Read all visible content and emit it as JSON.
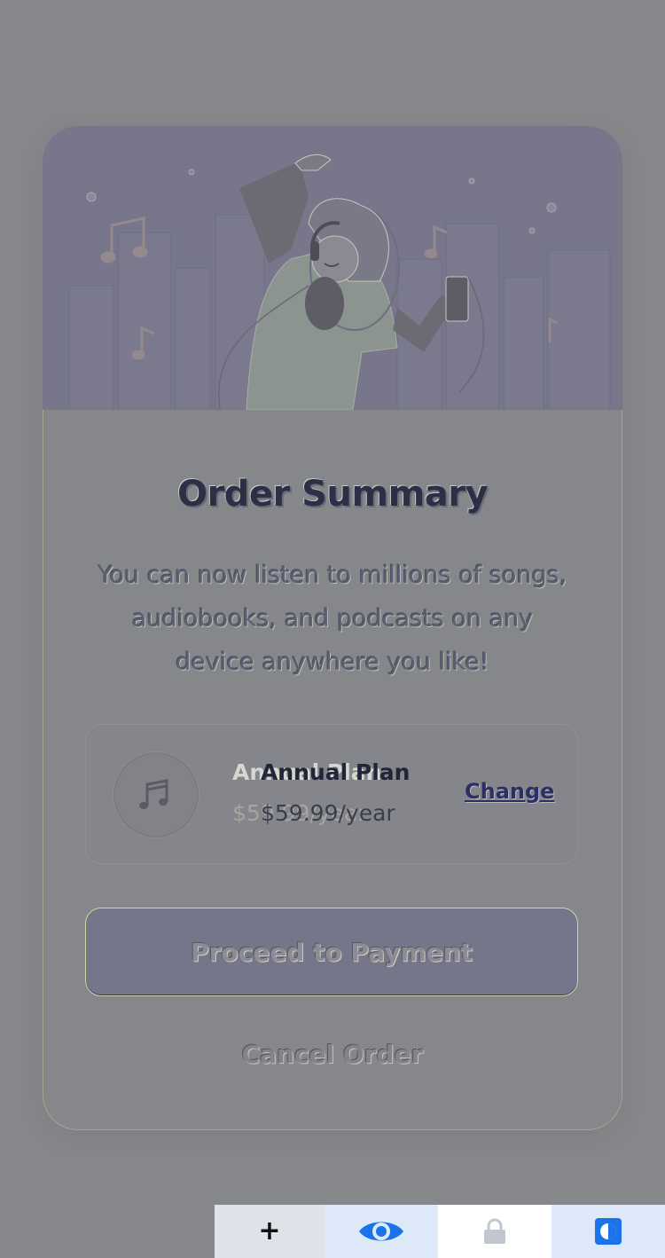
{
  "order": {
    "title": "Order Summary",
    "description": "You can now listen to millions of songs, audiobooks, and podcasts on any device anywhere you like!",
    "plan_name": "Annual Plan",
    "plan_price": "$59.99/year",
    "change_label": "Change",
    "proceed_label": "Proceed to Payment",
    "cancel_label": "Cancel Order"
  },
  "icons": {
    "hero": "woman-dancing-with-headphones-illustration",
    "plan": "music-note-icon"
  },
  "toolbar": {
    "add_symbol": "+",
    "items": [
      "add-icon",
      "eye-icon",
      "lock-icon",
      "contrast-icon"
    ]
  },
  "colors": {
    "background": "#86878a",
    "hero_bg": "#77768a",
    "title": "#2d2f47",
    "button_bg": "#76768a",
    "link": "#2c2e69",
    "eye_icon": "#1a73e8",
    "contrast_icon": "#1a73e8"
  }
}
